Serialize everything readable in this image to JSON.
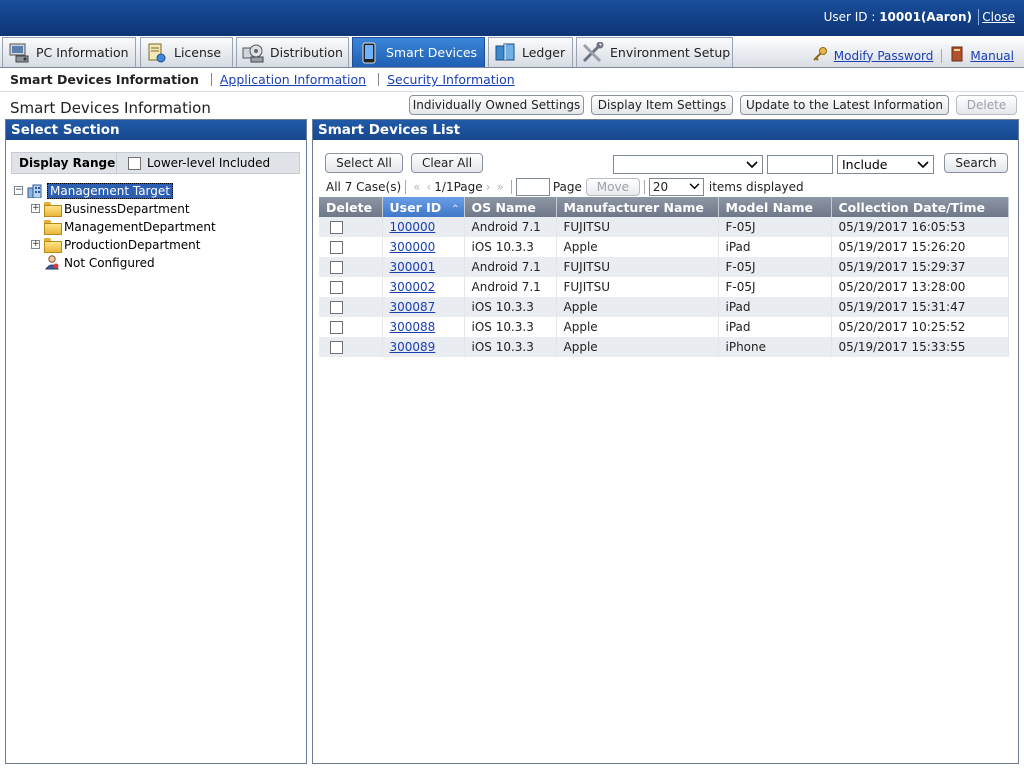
{
  "header": {
    "user_label": "User ID : ",
    "user_value": "10001(Aaron)",
    "close": "Close"
  },
  "tabs": [
    {
      "label": "PC Information",
      "icon": "pc-icon"
    },
    {
      "label": "License",
      "icon": "license-icon"
    },
    {
      "label": "Distribution",
      "icon": "distribution-icon"
    },
    {
      "label": "Smart Devices",
      "icon": "smart-device-icon",
      "active": true
    },
    {
      "label": "Ledger",
      "icon": "ledger-icon"
    },
    {
      "label": "Environment Setup",
      "icon": "tools-icon"
    }
  ],
  "header_links": {
    "modify_password": "Modify Password",
    "manual": "Manual"
  },
  "subnav": {
    "current": "Smart Devices Information",
    "link1": "Application Information",
    "link2": "Security Information"
  },
  "page": {
    "title": "Smart Devices Information",
    "buttons": {
      "owned": "Individually Owned Settings",
      "display": "Display Item Settings",
      "update": "Update to the Latest Information",
      "delete": "Delete"
    }
  },
  "left": {
    "title": "Select Section",
    "range_label": "Display Range",
    "lower_level": "Lower-level Included",
    "tree": {
      "root": "Management Target",
      "n1": "BusinessDepartment",
      "n2": "ManagementDepartment",
      "n3": "ProductionDepartment",
      "n4": "Not Configured"
    }
  },
  "right": {
    "title": "Smart Devices List",
    "select_all": "Select All",
    "clear_all": "Clear All",
    "filter_field": "",
    "filter_text": "",
    "filter_mode": "Include",
    "search": "Search",
    "case_count": "All 7 Case(s)",
    "page_info": "1/1Page",
    "page_label": "Page",
    "move": "Move",
    "per_page": "20",
    "items_displayed": "items displayed",
    "columns": [
      "Delete",
      "User ID",
      "OS Name",
      "Manufacturer Name",
      "Model Name",
      "Collection Date/Time"
    ],
    "rows": [
      {
        "id": "100000",
        "os": "Android 7.1",
        "mfr": "FUJITSU",
        "model": "F-05J",
        "date": "05/19/2017 16:05:53"
      },
      {
        "id": "300000",
        "os": "iOS 10.3.3",
        "mfr": "Apple",
        "model": "iPad",
        "date": "05/19/2017 15:26:20"
      },
      {
        "id": "300001",
        "os": "Android 7.1",
        "mfr": "FUJITSU",
        "model": "F-05J",
        "date": "05/19/2017 15:29:37"
      },
      {
        "id": "300002",
        "os": "Android 7.1",
        "mfr": "FUJITSU",
        "model": "F-05J",
        "date": "05/20/2017 13:28:00"
      },
      {
        "id": "300087",
        "os": "iOS 10.3.3",
        "mfr": "Apple",
        "model": "iPad",
        "date": "05/19/2017 15:31:47"
      },
      {
        "id": "300088",
        "os": "iOS 10.3.3",
        "mfr": "Apple",
        "model": "iPad",
        "date": "05/20/2017 10:25:52"
      },
      {
        "id": "300089",
        "os": "iOS 10.3.3",
        "mfr": "Apple",
        "model": "iPhone",
        "date": "05/19/2017 15:33:55"
      }
    ]
  }
}
